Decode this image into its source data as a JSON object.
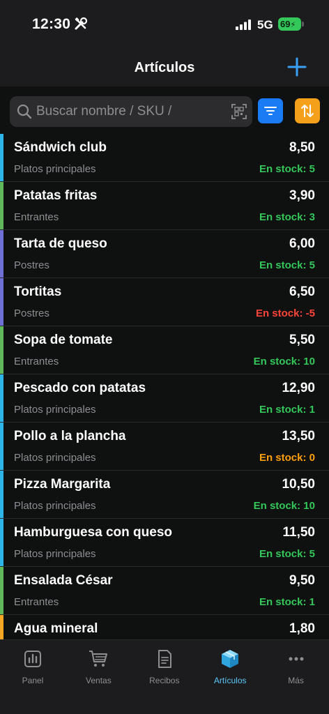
{
  "status_bar": {
    "time": "12:30",
    "network": "5G",
    "battery": "69"
  },
  "nav": {
    "title": "Artículos"
  },
  "search": {
    "placeholder": "Buscar nombre / SKU /"
  },
  "colors": {
    "accent": "#1a7cf5",
    "sort": "#f5a01a",
    "stock_ok": "#34c759",
    "stock_negative": "#ff453a",
    "stock_zero": "#ff9f0a",
    "category_platos": "#2fb4e8",
    "category_entrantes": "#5fb85a",
    "category_postres": "#6f6fd6",
    "category_bebidas": "#f5a623"
  },
  "items": [
    {
      "name": "Sándwich club",
      "price": "8,50",
      "category": "Platos principales",
      "stock": "En stock: 5",
      "stock_status": "ok",
      "color": "#2fb4e8"
    },
    {
      "name": "Patatas fritas",
      "price": "3,90",
      "category": "Entrantes",
      "stock": "En stock: 3",
      "stock_status": "ok",
      "color": "#5fb85a"
    },
    {
      "name": "Tarta de queso",
      "price": "6,00",
      "category": "Postres",
      "stock": "En stock: 5",
      "stock_status": "ok",
      "color": "#6f6fd6"
    },
    {
      "name": "Tortitas",
      "price": "6,50",
      "category": "Postres",
      "stock": "En stock: -5",
      "stock_status": "negative",
      "color": "#6f6fd6"
    },
    {
      "name": "Sopa de tomate",
      "price": "5,50",
      "category": "Entrantes",
      "stock": "En stock: 10",
      "stock_status": "ok",
      "color": "#5fb85a"
    },
    {
      "name": "Pescado con patatas",
      "price": "12,90",
      "category": "Platos principales",
      "stock": "En stock: 1",
      "stock_status": "ok",
      "color": "#2fb4e8"
    },
    {
      "name": "Pollo a la plancha",
      "price": "13,50",
      "category": "Platos principales",
      "stock": "En stock: 0",
      "stock_status": "zero",
      "color": "#2fb4e8"
    },
    {
      "name": "Pizza Margarita",
      "price": "10,50",
      "category": "Platos principales",
      "stock": "En stock: 10",
      "stock_status": "ok",
      "color": "#2fb4e8"
    },
    {
      "name": "Hamburguesa con queso",
      "price": "11,50",
      "category": "Platos principales",
      "stock": "En stock: 5",
      "stock_status": "ok",
      "color": "#2fb4e8"
    },
    {
      "name": "Ensalada César",
      "price": "9,50",
      "category": "Entrantes",
      "stock": "En stock: 1",
      "stock_status": "ok",
      "color": "#5fb85a"
    },
    {
      "name": "Agua mineral",
      "price": "1,80",
      "category": "",
      "stock": "",
      "stock_status": "ok",
      "color": "#f5a623"
    }
  ],
  "tabs": [
    {
      "label": "Panel",
      "icon": "chart-icon",
      "active": false
    },
    {
      "label": "Ventas",
      "icon": "cart-icon",
      "active": false
    },
    {
      "label": "Recibos",
      "icon": "receipt-icon",
      "active": false
    },
    {
      "label": "Artículos",
      "icon": "box-icon",
      "active": true
    },
    {
      "label": "Más",
      "icon": "more-icon",
      "active": false
    }
  ]
}
